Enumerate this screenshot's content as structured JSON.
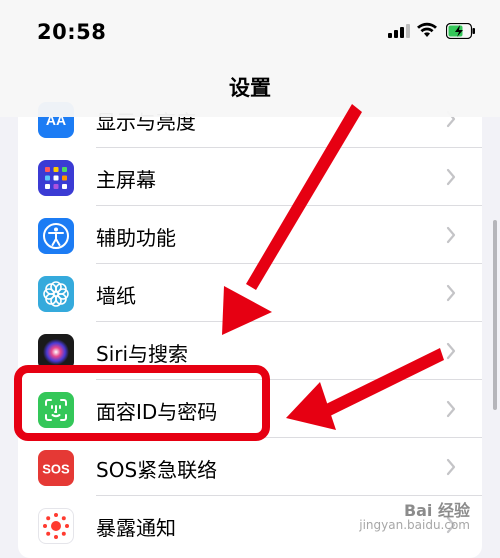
{
  "status_bar": {
    "time": "20:58",
    "icons": [
      "cellular-signal-icon",
      "wifi-icon",
      "battery-charging-icon"
    ]
  },
  "nav": {
    "title": "设置"
  },
  "settings_rows": [
    {
      "label": "显示与亮度",
      "icon": "display-brightness-icon",
      "color": "#1c7cf4"
    },
    {
      "label": "主屏幕",
      "icon": "home-screen-icon",
      "color": "#3b3bd4"
    },
    {
      "label": "辅助功能",
      "icon": "accessibility-icon",
      "color": "#1c7cf4"
    },
    {
      "label": "墙纸",
      "icon": "wallpaper-icon",
      "color": "#35aadc"
    },
    {
      "label": "Siri与搜索",
      "icon": "siri-icon",
      "color": "#222222"
    },
    {
      "label": "面容ID与密码",
      "icon": "face-id-icon",
      "color": "#34c759"
    },
    {
      "label": "SOS紧急联络",
      "icon": "sos-icon",
      "color": "#e53935"
    },
    {
      "label": "暴露通知",
      "icon": "exposure-notification-icon",
      "color": "#ffffff"
    }
  ],
  "annotation": {
    "highlight_color": "#e60012",
    "highlighted_row": "面容ID与密码"
  },
  "watermark": {
    "logo": "Bai 经验",
    "url": "jingyan.baidu.com"
  }
}
